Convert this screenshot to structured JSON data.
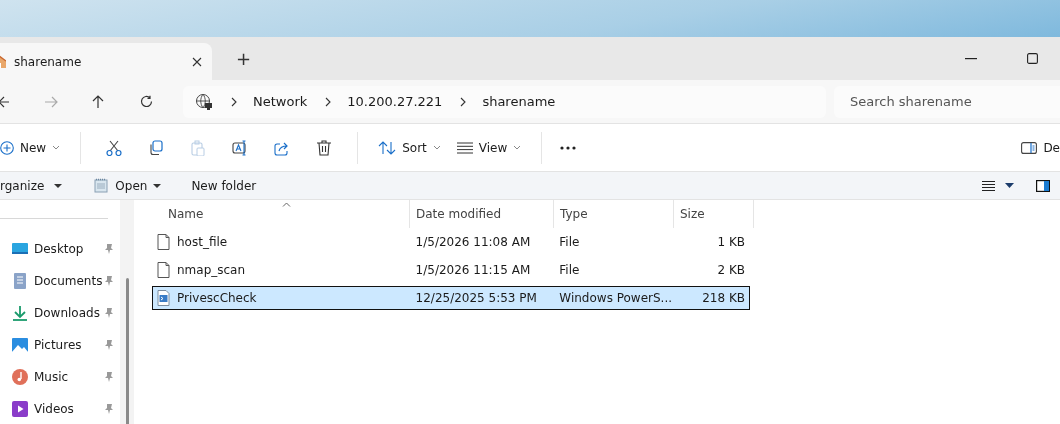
{
  "tab": {
    "title": "sharename",
    "selected": true
  },
  "new_tab": "+",
  "address": {
    "crumbs": [
      "Network",
      "10.200.27.221",
      "sharename"
    ]
  },
  "search": {
    "placeholder": "Search sharename"
  },
  "command_bar": {
    "new": "New",
    "sort": "Sort",
    "view": "View",
    "details": "De"
  },
  "secondary_bar": {
    "organize": "rganize",
    "open": "Open",
    "new_folder": "New folder"
  },
  "sidebar": {
    "items": [
      {
        "label": "Desktop",
        "kind": "desktop",
        "pinned": true
      },
      {
        "label": "Documents",
        "kind": "documents",
        "pinned": true
      },
      {
        "label": "Downloads",
        "kind": "downloads",
        "pinned": true
      },
      {
        "label": "Pictures",
        "kind": "pictures",
        "pinned": true
      },
      {
        "label": "Music",
        "kind": "music",
        "pinned": true
      },
      {
        "label": "Videos",
        "kind": "videos",
        "pinned": true
      }
    ]
  },
  "table": {
    "columns": [
      "Name",
      "Date modified",
      "Type",
      "Size"
    ],
    "rows": [
      {
        "name": "host_file",
        "date": "1/5/2026 11:08 AM",
        "type": "File",
        "size": "1 KB",
        "kind": "file",
        "selected": false
      },
      {
        "name": "nmap_scan",
        "date": "1/5/2026 11:15 AM",
        "type": "File",
        "size": "2 KB",
        "kind": "file",
        "selected": false
      },
      {
        "name": "PrivescCheck",
        "date": "12/25/2025 5:53 PM",
        "type": "Windows PowerS...",
        "size": "218 KB",
        "kind": "script",
        "selected": true
      }
    ]
  }
}
